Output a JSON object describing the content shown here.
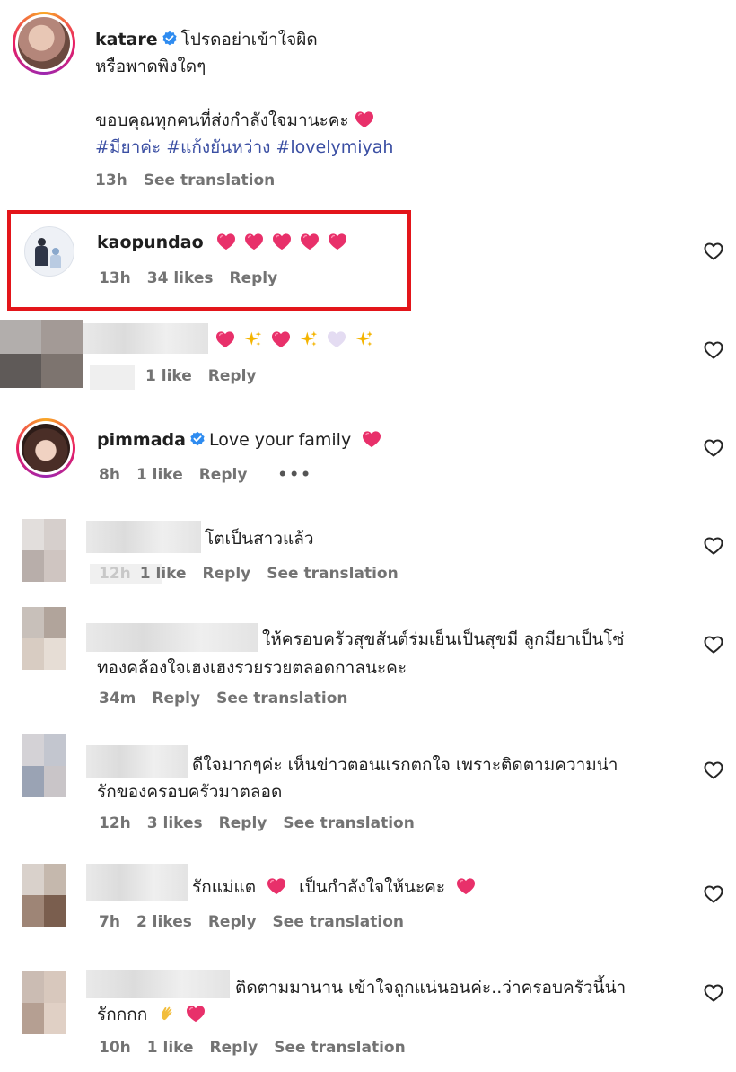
{
  "comments": [
    {
      "username": "katare",
      "verified": true,
      "line1": "โปรดอย่าเข้าใจผิด",
      "line2": "หรือพาดพิงใดๆ",
      "line3": "ขอบคุณทุกคนที่ส่งกำลังใจมานะคะ",
      "hashtags": "#มียาค่ะ #แก้งยันหว่าง #lovelymiyah",
      "time": "13h",
      "translation": "See translation"
    },
    {
      "username": "kaopundao",
      "highlighted": true,
      "time": "13h",
      "likes": "34 likes",
      "reply": "Reply"
    },
    {
      "username_blurred": true,
      "likes": "1 like",
      "reply": "Reply"
    },
    {
      "username": "pimmada",
      "verified": true,
      "text": "Love your family",
      "time": "8h",
      "likes": "1 like",
      "reply": "Reply",
      "more": "•••"
    },
    {
      "username_blurred": true,
      "text": "โตเป็นสาวแล้ว",
      "time_partial": "12h",
      "likes_partial": "1 like",
      "reply": "Reply",
      "translation": "See translation"
    },
    {
      "username_blurred": true,
      "line1": "ให้ครอบครัวสุขสันต์ร่มเย็นเป็นสุขมี ลูกมียาเป็นโซ่",
      "line2": "ทองคล้องใจเฮงเฮงรวยรวยตลอดกาลนะคะ",
      "time": "34m",
      "reply": "Reply",
      "translation": "See translation"
    },
    {
      "username_blurred": true,
      "line1": "ดีใจมากๆค่ะ เห็นข่าวตอนแรกตกใจ เพราะติดตามความน่า",
      "line2": "รักของครอบครัวมาตลอด",
      "time": "12h",
      "likes": "3 likes",
      "reply": "Reply",
      "translation": "See translation"
    },
    {
      "username_blurred": true,
      "text_a": "รักแม่แต",
      "text_b": "เป็นกำลังใจให้นะคะ",
      "time": "7h",
      "likes": "2 likes",
      "reply": "Reply",
      "translation": "See translation"
    },
    {
      "username_blurred": true,
      "line1": "ติดตามมานาน เข้าใจถูกแน่นอนค่ะ..ว่าครอบครัวนี้น่า",
      "line2": "รักกกก",
      "time": "10h",
      "likes": "1 like",
      "reply": "Reply",
      "translation": "See translation"
    }
  ],
  "colors": {
    "highlight_border": "#e3151a",
    "meta_text": "#737373",
    "hashtag": "#3b4fa3",
    "verified": "#2f8cf0",
    "heart_emoji": "#e8306a"
  },
  "icons": {
    "like": "heart-outline-icon",
    "verified": "verified-badge-icon",
    "emoji": "heart-emoji-icon"
  }
}
